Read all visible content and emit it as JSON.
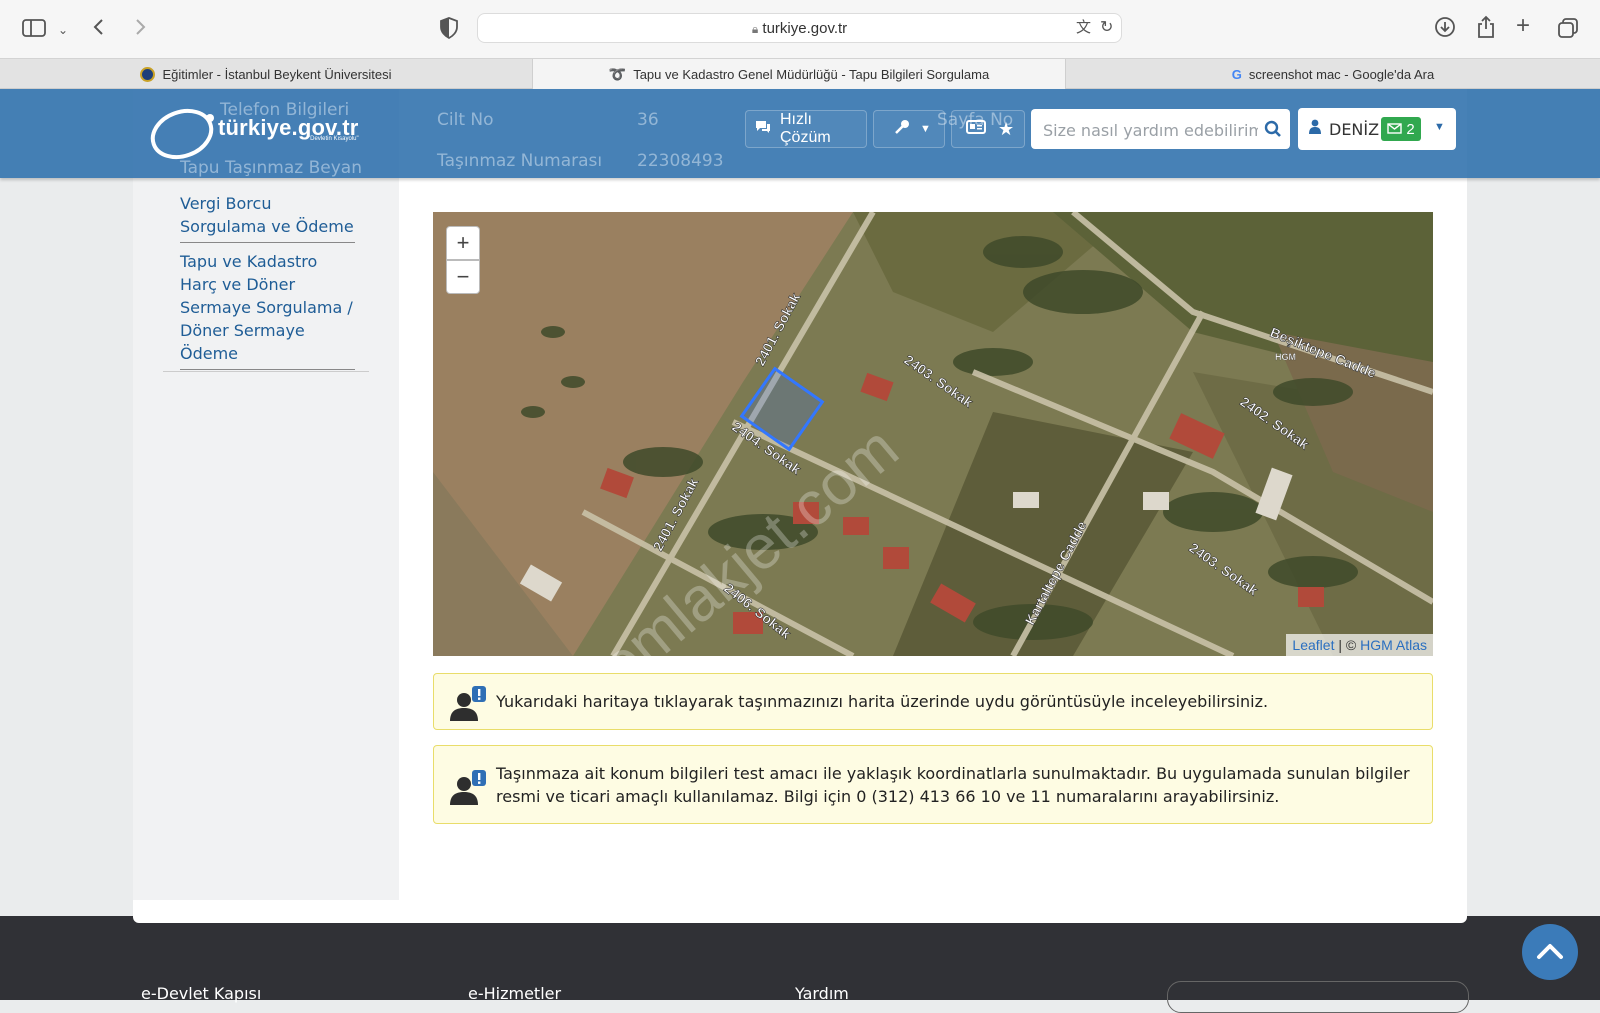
{
  "browser": {
    "url": "turkiye.gov.tr",
    "tabs": [
      {
        "label": "Eğitimler - İstanbul Beykent Üniversitesi"
      },
      {
        "label": "Tapu ve Kadastro Genel Müdürlüğü - Tapu Bilgileri Sorgulama"
      },
      {
        "label": "screenshot mac - Google'da Ara"
      }
    ]
  },
  "header": {
    "logo": "türkiye.gov.tr",
    "logo_tagline": "\"Devletin Kısayolu\"",
    "quick_solution": "Hızlı Çözüm",
    "search_placeholder": "Size nasıl yardım edebilirim?",
    "user_name": "DENİZ",
    "mail_count": "2"
  },
  "behind_header": {
    "telefon": "Telefon Bilgileri",
    "tapu_beyan": "Tapu Taşınmaz Beyan",
    "cilt_label": "Cilt No",
    "cilt_value": "36",
    "sayfa_label": "Sayfa No",
    "tasinmaz_label": "Taşınmaz Numarası",
    "tasinmaz_value": "22308493"
  },
  "sidebar": {
    "items": [
      {
        "label": "Vergi Borcu Sorgulama ve Ödeme"
      },
      {
        "label": "Tapu ve Kadastro Harç ve Döner Sermaye Sorgulama / Döner Sermaye Ödeme"
      }
    ]
  },
  "map": {
    "zoom_in": "+",
    "zoom_out": "−",
    "attribution_leaflet": "Leaflet",
    "attribution_sep": " | © ",
    "attribution_hgm": "HGM Atlas",
    "watermark": "emlakjet.com",
    "streets": [
      "2401. Sokak",
      "2403. Sokak",
      "2404. Sokak",
      "2401. Sokak",
      "2406. Sokak",
      "Beşiktepe Cadde",
      "2402. Sokak",
      "Kartaltepe Cadde",
      "2403. Sokak",
      "HGM"
    ]
  },
  "alerts": [
    {
      "text": "Yukarıdaki haritaya tıklayarak taşınmazınızı harita üzerinde uydu görüntüsüyle inceleyebilirsiniz."
    },
    {
      "text": "Taşınmaza ait konum bilgileri test amacı ile yaklaşık koordinatlarla sunulmaktadır. Bu uygulamada sunulan bilgiler resmi ve ticari amaçlı kullanılamaz. Bilgi için 0 (312) 413 66 10 ve 11 numaralarını arayabilirsiniz."
    }
  ],
  "footer": {
    "col1": "e-Devlet Kapısı",
    "col2": "e-Hizmetler",
    "col3": "Yardım"
  }
}
